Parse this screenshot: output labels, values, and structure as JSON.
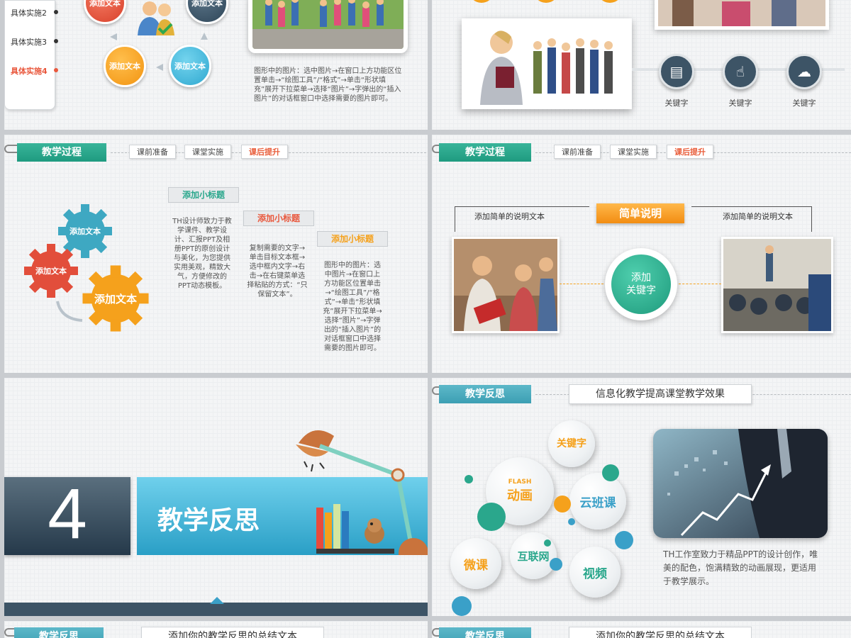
{
  "top_left": {
    "menu": [
      "具体实施2",
      "具体实施3",
      "具体实施4"
    ],
    "circles": [
      "添加文本",
      "添加文本",
      "添加文本",
      "添加文本"
    ],
    "caption": "图形中的图片：选中图片→在窗口上方功能区位置单击→“绘图工具”/“格式”→单击“形状填充”展开下拉菜单→选择“图片”→字弹出的“插入图片”的对话框窗口中选择需要的图片即可。"
  },
  "top_right": {
    "keywords": [
      "关键字",
      "关键字",
      "关键字"
    ],
    "icons": [
      "presentation-icon",
      "touch-icon",
      "cloud-download-icon"
    ]
  },
  "slide2": {
    "tab": "教学过程",
    "nav": [
      "课前准备",
      "课堂实施",
      "课后提升"
    ],
    "gears": [
      "添加文本",
      "添加文本",
      "添加文本"
    ],
    "subtitles": [
      "添加小标题",
      "添加小标题",
      "添加小标题"
    ],
    "texts": [
      "TH设计师致力于教学课件、教学设计、汇报PPT及相册PPT的原创设计与美化，为您提供实用美观，精致大气，方便修改的PPT动态模板。",
      "复制需要的文字→单击目标文本框→选中框内文字→右击→在右键菜单选择粘贴的方式：“只保留文本”。",
      "图形中的图片：选中图片→在窗口上方功能区位置单击→“绘图工具”/“格式”→单击“形状填充”展开下拉菜单→选择“图片”→字弹出的“插入图片”的对话框窗口中选择需要的图片即可。"
    ]
  },
  "slide3": {
    "tab": "教学过程",
    "nav": [
      "课前准备",
      "课堂实施",
      "课后提升"
    ],
    "badge": "简单说明",
    "left_text": "添加简单的说明文本",
    "right_text": "添加简单的说明文本",
    "center": [
      "添加",
      "关键字"
    ]
  },
  "slide4": {
    "number": "4",
    "title": "教学反思"
  },
  "slide5": {
    "tab": "教学反思",
    "headline": "信息化教学提高课堂教学效果",
    "bubbles": [
      "关键字",
      "FLASH",
      "动画",
      "云班课",
      "微课",
      "互联网",
      "视频"
    ],
    "description": "TH工作室致力于精品PPT的设计创作，唯美的配色，饱满精致的动画展现，更适用于教学展示。"
  },
  "bottom": {
    "tab_left": "教学反思",
    "text_left": "添加你的教学反思的总结文本",
    "tab_right": "教学反思",
    "text_right": "添加你的教学反思的总结文本"
  },
  "colors": {
    "green": "#2aa78c",
    "teal": "#4aaabd",
    "orange": "#f5a11c",
    "red": "#e9583d",
    "dark": "#3d5466"
  }
}
